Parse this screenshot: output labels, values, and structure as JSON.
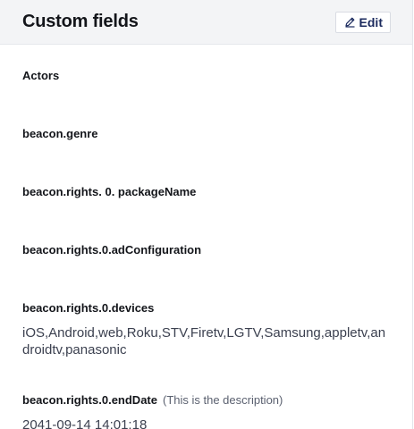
{
  "header": {
    "title": "Custom fields",
    "edit_label": "Edit"
  },
  "fields": [
    {
      "label": "Actors",
      "value": ""
    },
    {
      "label": "beacon.genre",
      "value": ""
    },
    {
      "label": "beacon.rights. 0. packageName",
      "value": ""
    },
    {
      "label": "beacon.rights.0.adConfiguration",
      "value": ""
    },
    {
      "label": "beacon.rights.0.devices",
      "value": "iOS,Android,web,Roku,STV,Firetv,LGTV,Samsung,appletv,androidtv,panasonic"
    },
    {
      "label": "beacon.rights.0.endDate",
      "description": "(This is the description)",
      "value": "2041-09-14 14:01:18"
    }
  ]
}
